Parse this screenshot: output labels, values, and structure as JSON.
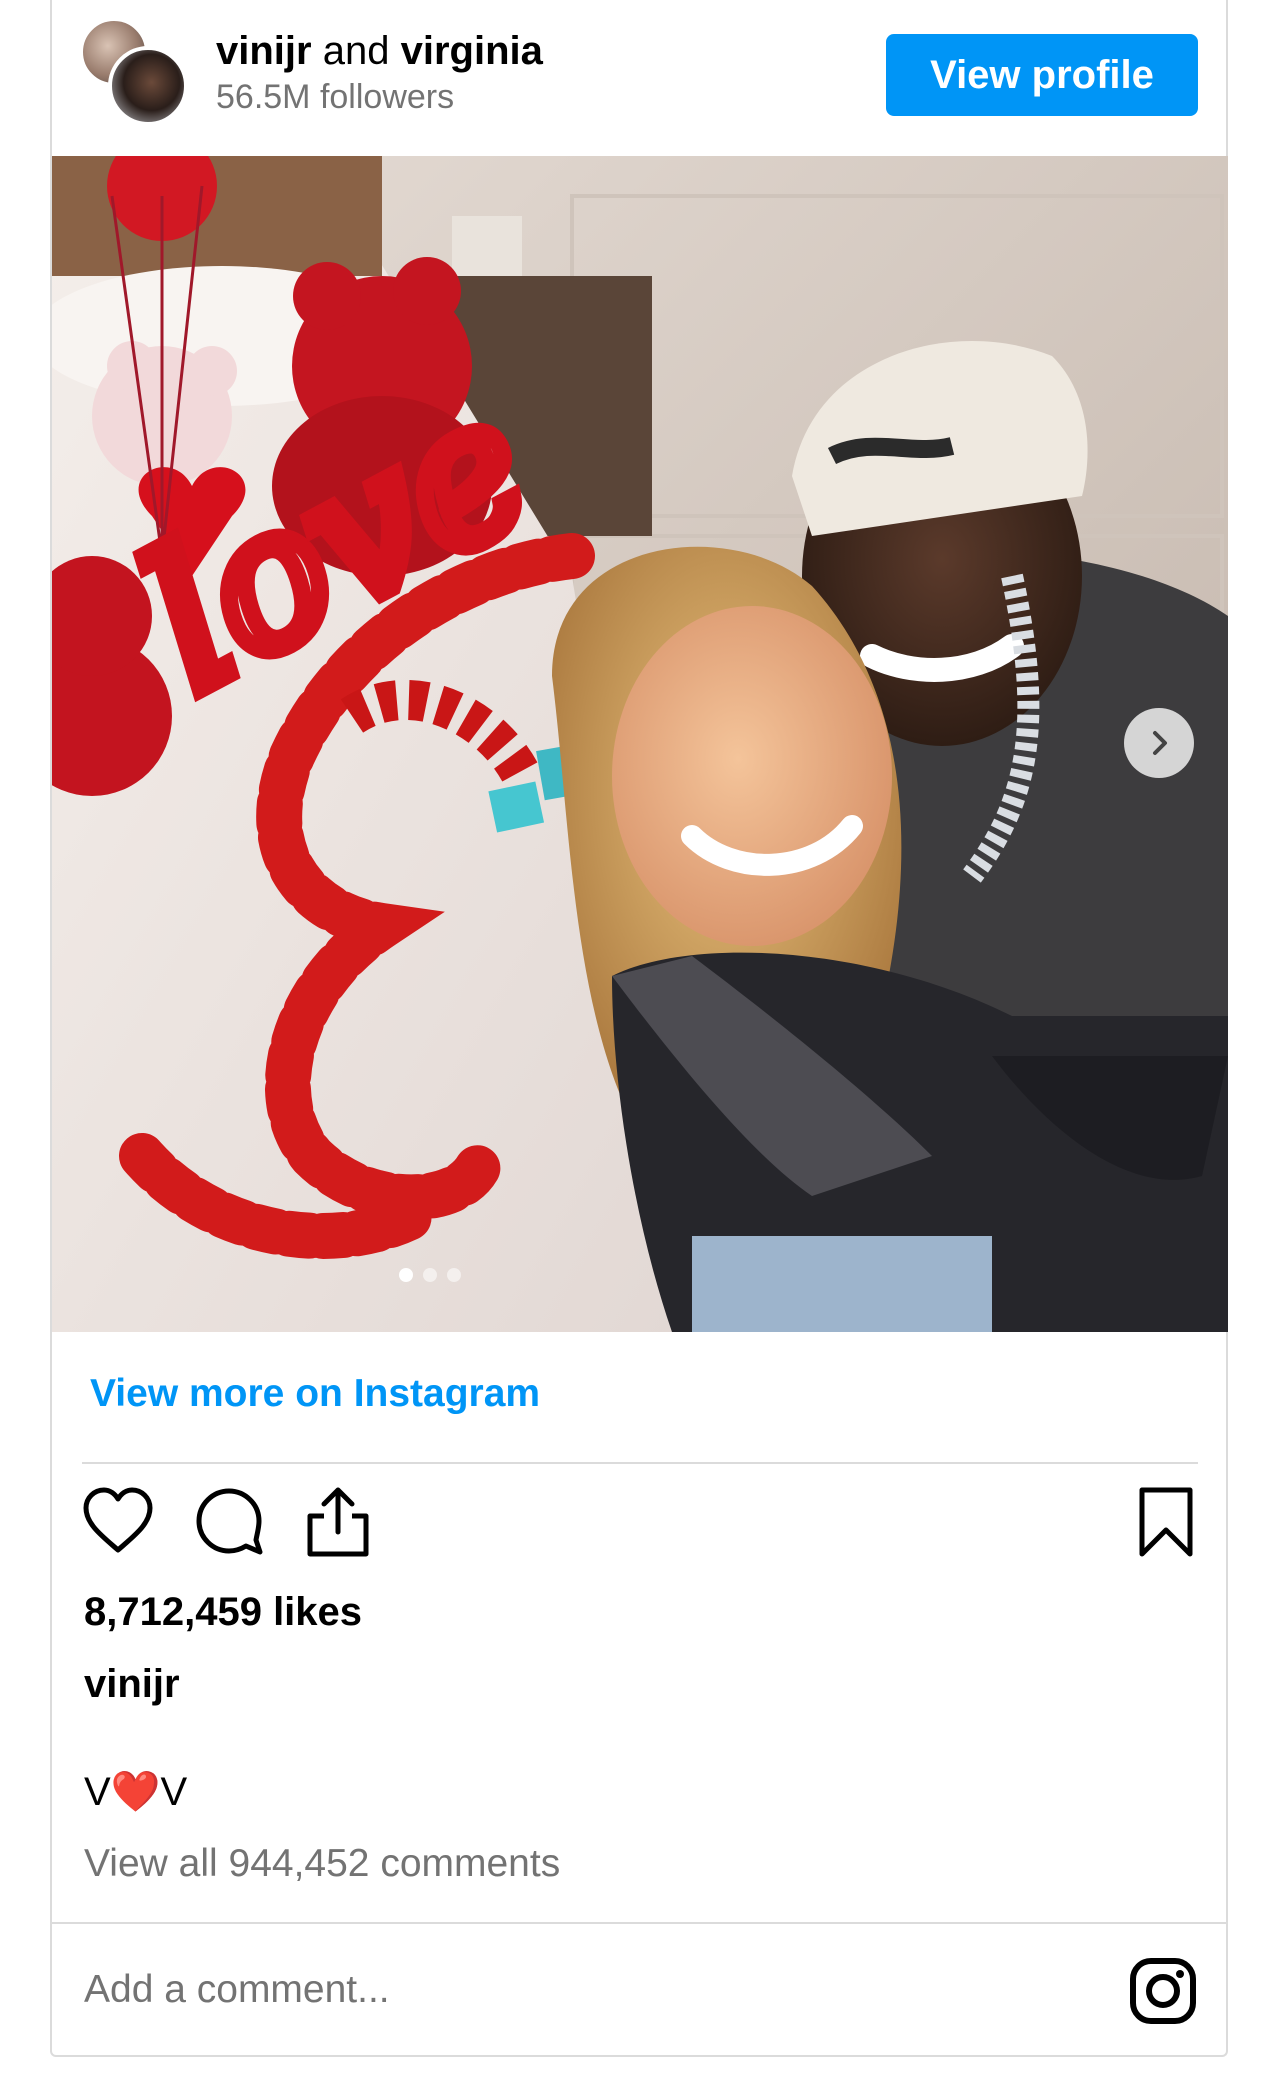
{
  "header": {
    "user1": "vinijr",
    "conj": "and",
    "user2": "virginia",
    "followers": "56.5M followers",
    "view_profile_label": "View profile"
  },
  "photo": {
    "balloon_text": "love",
    "carousel_total": 3,
    "carousel_active": 1
  },
  "view_more_label": "View more on Instagram",
  "actions": {
    "icons": [
      "heart-icon",
      "comment-icon",
      "share-icon",
      "bookmark-icon"
    ]
  },
  "likes": "8,712,459 likes",
  "caption": {
    "username": "vinijr",
    "text_before": "V",
    "emoji": "❤️",
    "text_after": "V"
  },
  "view_comments": "View all 944,452 comments",
  "add_comment_placeholder": "Add a comment...",
  "colors": {
    "accent": "#0095f6",
    "muted": "#737373",
    "border": "#dbdbdb"
  }
}
